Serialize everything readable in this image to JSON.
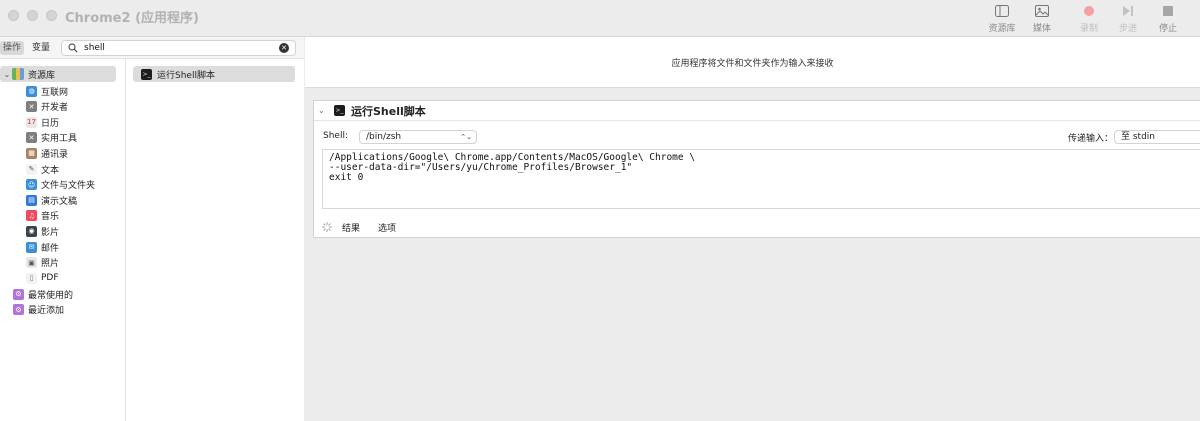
{
  "window": {
    "title": "Chrome2 (应用程序)"
  },
  "toolbar": {
    "library": "资源库",
    "media": "媒体",
    "record": "录制",
    "step": "步进",
    "stop": "停止"
  },
  "filter": {
    "actions_tab": "操作",
    "variables_tab": "变量",
    "search_value": "shell"
  },
  "library": {
    "header": "资源库",
    "items": [
      {
        "label": "互联网",
        "icon": "globe-icon",
        "color": "#3b8fd9"
      },
      {
        "label": "开发者",
        "icon": "tools-icon",
        "color": "#7f7f7f"
      },
      {
        "label": "日历",
        "icon": "calendar-icon",
        "color": "#e8e8e8"
      },
      {
        "label": "实用工具",
        "icon": "utilities-icon",
        "color": "#7f7f7f"
      },
      {
        "label": "通讯录",
        "icon": "contacts-icon",
        "color": "#a9835a"
      },
      {
        "label": "文本",
        "icon": "text-icon",
        "color": "#f2f2f2"
      },
      {
        "label": "文件与文件夹",
        "icon": "finder-icon",
        "color": "#3b8fd9"
      },
      {
        "label": "演示文稿",
        "icon": "keynote-icon",
        "color": "#2e7ad9"
      },
      {
        "label": "音乐",
        "icon": "music-icon",
        "color": "#f24a5a"
      },
      {
        "label": "影片",
        "icon": "movie-icon",
        "color": "#3a4450"
      },
      {
        "label": "邮件",
        "icon": "mail-icon",
        "color": "#3b8fd9"
      },
      {
        "label": "照片",
        "icon": "photos-icon",
        "color": "#e8e8e8"
      },
      {
        "label": "PDF",
        "icon": "pdf-icon",
        "color": "#f2f2f2"
      }
    ],
    "smart": [
      {
        "label": "最常使用的",
        "icon": "smart-folder-icon",
        "color": "#b174d8"
      },
      {
        "label": "最近添加",
        "icon": "smart-folder-icon",
        "color": "#b174d8"
      }
    ]
  },
  "actions": {
    "result": "运行Shell脚本"
  },
  "workflow": {
    "receives_text": "应用程序将文件和文件夹作为输入来接收",
    "action": {
      "title": "运行Shell脚本",
      "shell_label": "Shell:",
      "shell_value": "/bin/zsh",
      "pass_label": "传递输入：",
      "pass_value": "至 stdin",
      "script": "/Applications/Google\\ Chrome.app/Contents/MacOS/Google\\ Chrome \\\n--user-data-dir=\"/Users/yu/Chrome_Profiles/Browser_1\"\nexit 0",
      "tab_results": "结果",
      "tab_options": "选项"
    }
  }
}
